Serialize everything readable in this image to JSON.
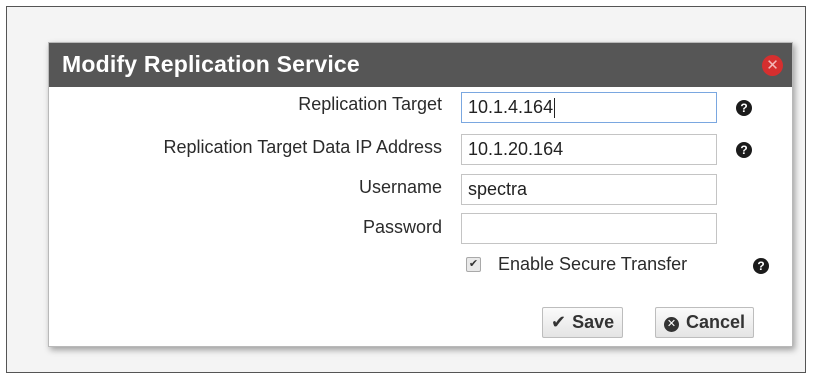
{
  "dialog": {
    "title": "Modify Replication Service",
    "close_icon": "close-circle-icon"
  },
  "fields": {
    "replication_target": {
      "label": "Replication Target",
      "value": "10.1.4.164"
    },
    "data_ip": {
      "label": "Replication Target Data IP Address",
      "value": "10.1.20.164"
    },
    "username": {
      "label": "Username",
      "value": "spectra"
    },
    "password": {
      "label": "Password",
      "value": ""
    }
  },
  "secure_transfer": {
    "label": "Enable Secure Transfer",
    "checked": true
  },
  "help_icon": "question-circle-icon",
  "help_glyph": "?",
  "buttons": {
    "save": "Save",
    "cancel": "Cancel"
  },
  "colors": {
    "titlebar": "#565656",
    "close": "#d62f2f"
  }
}
